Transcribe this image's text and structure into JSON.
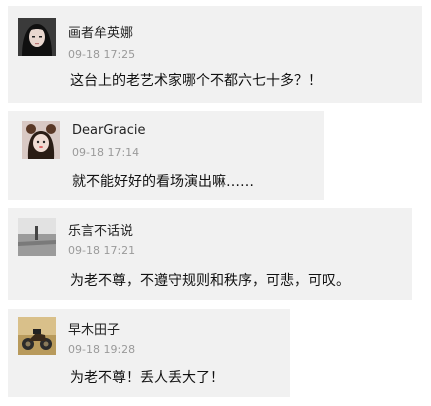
{
  "comments": [
    {
      "username": "画者牟英娜",
      "time": "09-18 17:25",
      "text": "这台上的老艺术家哪个不都六七十多？！",
      "avatar_icon": "avatar-woman-dark-hair-icon"
    },
    {
      "username": "DearGracie",
      "time": "09-18 17:14",
      "text": "就不能好好的看场演出嘛……",
      "avatar_icon": "avatar-girl-bear-ears-icon"
    },
    {
      "username": "乐言不话说",
      "time": "09-18 17:21",
      "text": "为老不尊，不遵守规则和秩序，可悲，可叹。",
      "avatar_icon": "avatar-gray-landscape-icon"
    },
    {
      "username": "早木田子",
      "time": "09-18 19:28",
      "text": "为老不尊！丢人丢大了！",
      "avatar_icon": "avatar-motorcycle-icon"
    }
  ]
}
